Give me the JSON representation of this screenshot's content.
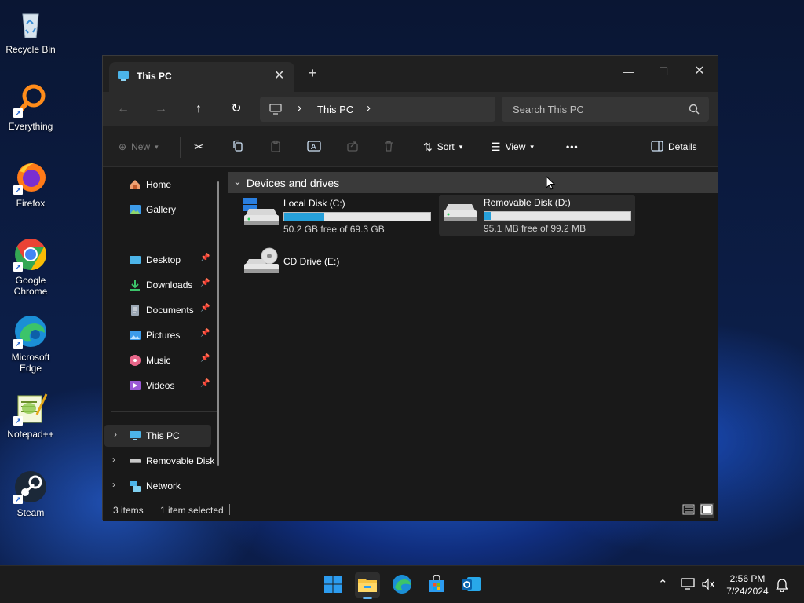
{
  "desktop": {
    "icons": [
      {
        "label": "Recycle Bin",
        "icon": "recycle-bin-icon"
      },
      {
        "label": "Everything",
        "icon": "everything-search-icon"
      },
      {
        "label": "Firefox",
        "icon": "firefox-icon"
      },
      {
        "label": "Google\nChrome",
        "label_line1": "Google",
        "label_line2": "Chrome",
        "icon": "chrome-icon"
      },
      {
        "label_line1": "Microsoft",
        "label_line2": "Edge",
        "icon": "edge-icon"
      },
      {
        "label": "Notepad++",
        "icon": "notepad-plus-plus-icon"
      },
      {
        "label": "Steam",
        "icon": "steam-icon"
      }
    ]
  },
  "window": {
    "tab_title": "This PC",
    "tab_close": "✕",
    "new_tab": "+",
    "controls": {
      "minimize": "—",
      "maximize": "☐",
      "close": "✕"
    }
  },
  "navigation": {
    "back": "←",
    "forward": "→",
    "up": "↑",
    "refresh": "↻",
    "breadcrumb": {
      "location": "This PC",
      "sep1": "›",
      "sep2": "›"
    },
    "search_placeholder": "Search This PC"
  },
  "toolbar": {
    "new_label": "New",
    "sort_label": "Sort",
    "view_label": "View",
    "more_label": "•••",
    "details_label": "Details"
  },
  "navpane": {
    "home": "Home",
    "gallery": "Gallery",
    "quick_access": [
      {
        "label": "Desktop",
        "icon": "desktop-folder-icon"
      },
      {
        "label": "Downloads",
        "icon": "downloads-folder-icon"
      },
      {
        "label": "Documents",
        "icon": "documents-folder-icon"
      },
      {
        "label": "Pictures",
        "icon": "pictures-folder-icon"
      },
      {
        "label": "Music",
        "icon": "music-folder-icon"
      },
      {
        "label": "Videos",
        "icon": "videos-folder-icon"
      }
    ],
    "pin_glyph": "📌",
    "tree": [
      {
        "label": "This PC",
        "selected": true
      },
      {
        "label": "Removable Disk"
      },
      {
        "label": "Network"
      }
    ],
    "chevron": "›"
  },
  "content": {
    "group_title": "Devices and drives",
    "group_chevron": "⌄",
    "drives": [
      {
        "name": "Local Disk (C:)",
        "free_text": "50.2 GB free of 69.3 GB",
        "used_fraction": 0.276,
        "icon": "windows-drive-icon"
      },
      {
        "name": "Removable Disk (D:)",
        "free_text": "95.1 MB free of 99.2 MB",
        "used_fraction": 0.041,
        "icon": "removable-drive-icon",
        "selected": true
      },
      {
        "name": "CD Drive (E:)",
        "icon": "cd-drive-icon"
      }
    ]
  },
  "status": {
    "items": "3 items",
    "selected": "1 item selected"
  },
  "taskbar": {
    "apps": [
      "windows-start-icon",
      "file-explorer-icon",
      "edge-icon",
      "microsoft-store-icon",
      "outlook-icon"
    ],
    "tray_chevron": "⌃",
    "time": "2:56 PM",
    "date": "7/24/2024"
  },
  "colors": {
    "accent": "#26a0da",
    "window_bg": "#191919",
    "taskbar_bg": "#1c1c1c"
  }
}
